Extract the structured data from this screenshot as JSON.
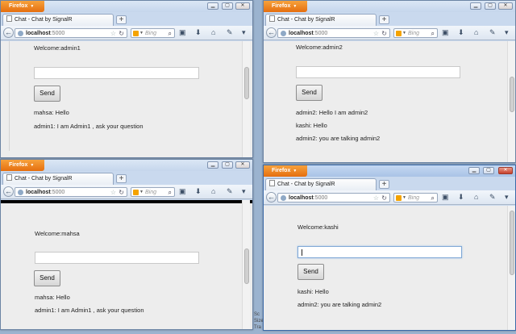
{
  "firefox_label": "Firefox",
  "tab_title": "Chat - Chat by SignalR",
  "new_tab": "+",
  "url_host": "localhost",
  "url_port": ":5000",
  "search_placeholder": "Bing",
  "send_label": "Send",
  "scraps": {
    "right_edge": "Sc\nSize\nTra"
  },
  "windows": {
    "admin1": {
      "welcome": "Welcome:admin1",
      "messages": [
        "mahsa: Hello",
        "admin1: I am Admin1 , ask your question"
      ]
    },
    "admin2": {
      "welcome": "Welcome:admin2",
      "messages": [
        "admin2: Hello I am admin2",
        "kashi: Hello",
        "admin2: you are talking admin2"
      ]
    },
    "mahsa": {
      "welcome": "Welcome:mahsa",
      "messages": [
        "mahsa: Hello",
        "admin1: I am Admin1 , ask your question"
      ]
    },
    "kashi": {
      "welcome": "Welcome:kashi",
      "messages": [
        "kashi: Hello",
        "admin2: you are talking admin2"
      ]
    }
  },
  "colors": {
    "firefox_orange": "#e56e0e",
    "page_bg": "#ededed",
    "desktop": "#9bb3cf"
  }
}
